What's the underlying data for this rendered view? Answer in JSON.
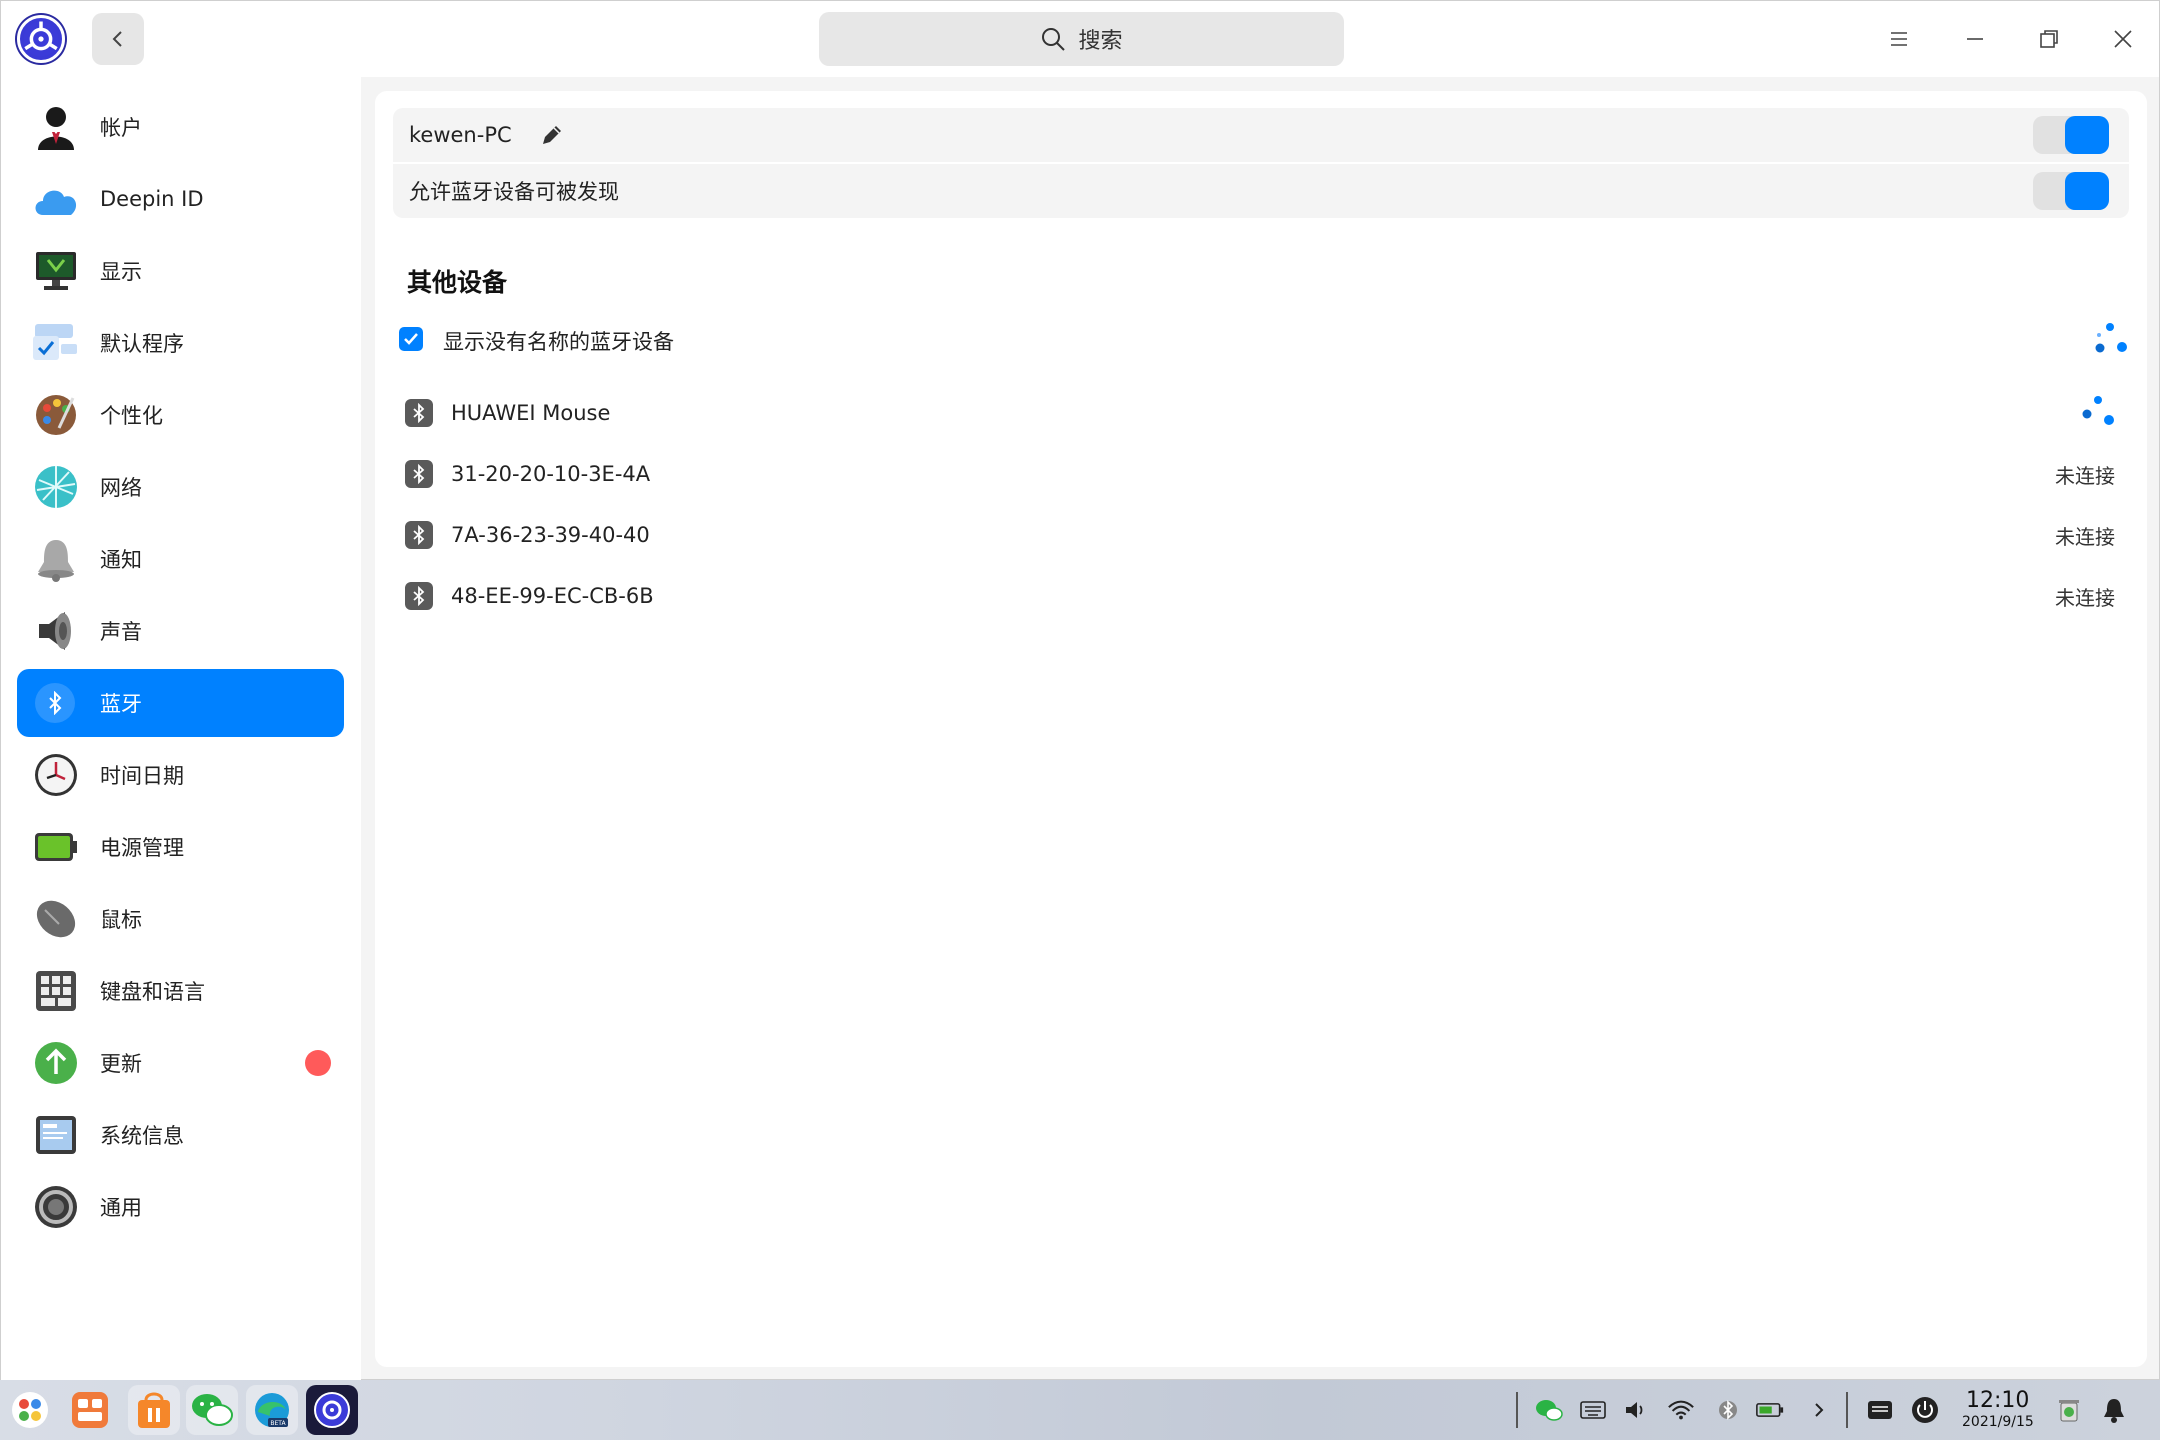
{
  "titlebar": {
    "search_placeholder": "搜索",
    "back_icon": "chevron-left-icon",
    "menu_icon": "hamburger-icon",
    "minimize_icon": "minimize-icon",
    "maximize_icon": "restore-icon",
    "close_icon": "close-icon"
  },
  "sidebar": {
    "items": [
      {
        "label": "帐户",
        "icon": "user-account-icon"
      },
      {
        "label": "Deepin ID",
        "icon": "cloud-icon"
      },
      {
        "label": "显示",
        "icon": "display-monitor-icon"
      },
      {
        "label": "默认程序",
        "icon": "default-apps-icon"
      },
      {
        "label": "个性化",
        "icon": "palette-icon"
      },
      {
        "label": "网络",
        "icon": "network-globe-icon"
      },
      {
        "label": "通知",
        "icon": "bell-icon"
      },
      {
        "label": "声音",
        "icon": "speaker-icon"
      },
      {
        "label": "蓝牙",
        "icon": "bluetooth-icon",
        "active": true
      },
      {
        "label": "时间日期",
        "icon": "clock-icon"
      },
      {
        "label": "电源管理",
        "icon": "battery-icon"
      },
      {
        "label": "鼠标",
        "icon": "mouse-icon"
      },
      {
        "label": "键盘和语言",
        "icon": "keyboard-icon"
      },
      {
        "label": "更新",
        "icon": "update-arrow-icon",
        "badge": true
      },
      {
        "label": "系统信息",
        "icon": "system-info-icon"
      },
      {
        "label": "通用",
        "icon": "general-settings-icon"
      }
    ]
  },
  "main": {
    "device_name": "kewen-PC",
    "device_toggle_on": true,
    "discoverable_label": "允许蓝牙设备可被发现",
    "discoverable_toggle_on": true,
    "other_devices_title": "其他设备",
    "show_unnamed_label": "显示没有名称的蓝牙设备",
    "show_unnamed_checked": true,
    "devices": [
      {
        "name": "HUAWEI  Mouse",
        "status": "",
        "connecting": true
      },
      {
        "name": "31-20-20-10-3E-4A",
        "status": "未连接"
      },
      {
        "name": "7A-36-23-39-40-40",
        "status": "未连接"
      },
      {
        "name": "48-EE-99-EC-CB-6B",
        "status": "未连接"
      }
    ]
  },
  "taskbar": {
    "apps": [
      "launcher-icon",
      "multitask-view-icon",
      "app-store-icon",
      "wechat-icon",
      "edge-beta-icon",
      "control-center-icon"
    ],
    "tray": [
      "wechat-tray-icon",
      "keyboard-tray-icon",
      "volume-icon",
      "wifi-icon",
      "bluetooth-tray-icon",
      "battery-tray-icon",
      "expand-tray-icon",
      "onscreen-keyboard-icon",
      "power-icon",
      "trash-icon",
      "notification-bell-icon"
    ],
    "time": "12:10",
    "date": "2021/9/15"
  },
  "colors": {
    "accent": "#0081ff",
    "badge": "#ff5a5a"
  }
}
